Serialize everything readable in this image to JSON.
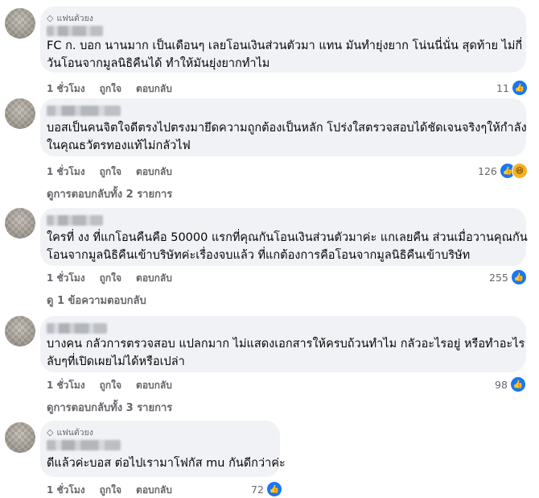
{
  "comments": [
    {
      "badge": "แฟนตัวยง",
      "text_lines": [
        "FC ก. บอก นานมาก เป็นเดือนๆ เลยโอนเงินส่วนตัวมา แทน มันทำยุ่งยาก โน่นนี่นั่น สุดท้าย ไม่กี่",
        "วันโอนจากมูลนิธิคืนได้ ทำให้มันยุ่งยากทำไม"
      ],
      "time": "1 ชั่วโมง",
      "like": "ถูกใจ",
      "reply": "ตอบกลับ",
      "reaction_count": "11"
    },
    {
      "badge": "",
      "text_lines": [
        "บอสเป็นคนจิตใจดีตรงไปตรงมายึดความถูกต้องเป็นหลัก โปร่งใสตรวจสอบได้ชัดเจนจริงๆให้กำลัง",
        "ในคุณธวัตรทองแท้ไม่กลัวไฟ"
      ],
      "time": "1 ชั่วโมง",
      "like": "ถูกใจ",
      "reply": "ตอบกลับ",
      "reaction_count": "126",
      "view_replies": "ดูการตอบกลับทั้ง 2 รายการ"
    },
    {
      "badge": "",
      "text_lines": [
        "ใครที่ งง ที่แกโอนคืนคือ 50000 แรกที่คุณกันโอนเงินส่วนตัวมาค่ะ แกเลยคืน ส่วนเมื่อวานคุณกัน",
        "โอนจากมูลนิธิคืนเข้าบริษัทค่ะเรื่องจบแล้ว ที่แกต้องการคือโอนจากมูลนิธิคืนเข้าบริษัท"
      ],
      "time": "1 ชั่วโมง",
      "like": "ถูกใจ",
      "reply": "ตอบกลับ",
      "reaction_count": "255",
      "view_replies": "ดู 1 ข้อความตอบกลับ"
    },
    {
      "badge": "",
      "text_lines": [
        "บางคน กลัวการตรวจสอบ แปลกมาก ไม่แสดงเอกสารให้ครบถ้วนทำไม กลัวอะไรอยู่ หรือทำอะไร",
        "ลับๆที่เปิดเผยไม่ได้หรือเปล่า"
      ],
      "time": "1 ชั่วโมง",
      "like": "ถูกใจ",
      "reply": "ตอบกลับ",
      "reaction_count": "98",
      "view_replies": "ดูการตอบกลับทั้ง 3 รายการ"
    },
    {
      "badge": "แฟนตัวยง",
      "text_lines": [
        "ดีแล้วค่ะบอส ต่อไปเรามาโฟกัส mu กันดีกว่าค่ะ"
      ],
      "time": "1 ชั่วโมง",
      "like": "ถูกใจ",
      "reply": "ตอบกลับ",
      "reaction_count": "72"
    }
  ]
}
